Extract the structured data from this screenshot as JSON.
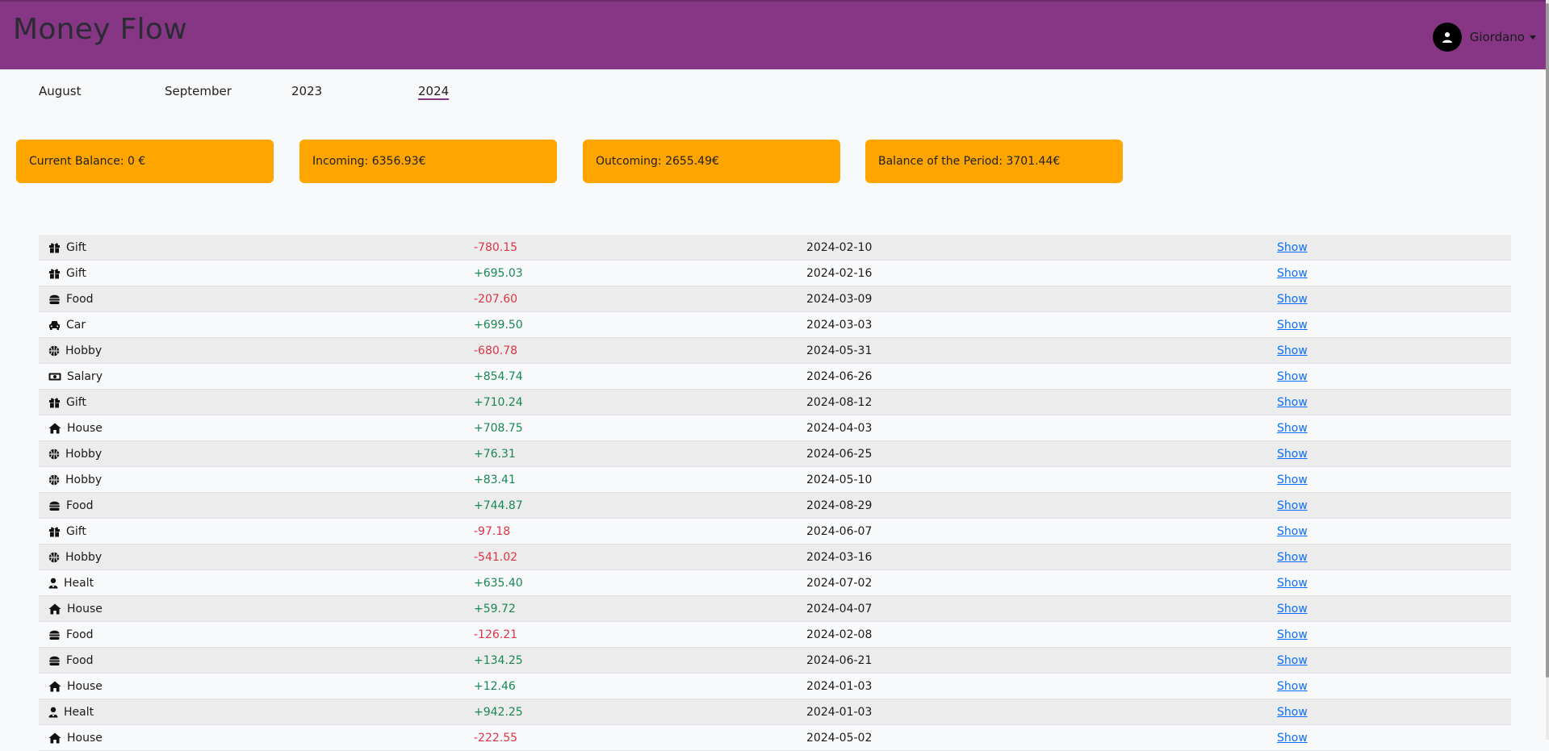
{
  "app": {
    "title": "Money Flow",
    "accent_color": "#873686",
    "card_color": "#ffa500"
  },
  "user": {
    "name": "Giordano",
    "icon": "user-icon"
  },
  "periods": [
    {
      "label": "August",
      "active": false
    },
    {
      "label": "September",
      "active": false
    },
    {
      "label": "2023",
      "active": false
    },
    {
      "label": "2024",
      "active": true
    }
  ],
  "summary": {
    "current_balance": "Current Balance: 0 €",
    "incoming": "Incoming: 6356.93€",
    "outcoming": "Outcoming: 2655.49€",
    "period_balance": "Balance of the Period: 3701.44€"
  },
  "transactions": [
    {
      "category": "Gift",
      "icon": "gift-icon",
      "amount": "-780.15",
      "date": "2024-02-10",
      "action": "Show"
    },
    {
      "category": "Gift",
      "icon": "gift-icon",
      "amount": "+695.03",
      "date": "2024-02-16",
      "action": "Show"
    },
    {
      "category": "Food",
      "icon": "burger-icon",
      "amount": "-207.60",
      "date": "2024-03-09",
      "action": "Show"
    },
    {
      "category": "Car",
      "icon": "car-icon",
      "amount": "+699.50",
      "date": "2024-03-03",
      "action": "Show"
    },
    {
      "category": "Hobby",
      "icon": "basketball-icon",
      "amount": "-680.78",
      "date": "2024-05-31",
      "action": "Show"
    },
    {
      "category": "Salary",
      "icon": "money-bill-icon",
      "amount": "+854.74",
      "date": "2024-06-26",
      "action": "Show"
    },
    {
      "category": "Gift",
      "icon": "gift-icon",
      "amount": "+710.24",
      "date": "2024-08-12",
      "action": "Show"
    },
    {
      "category": "House",
      "icon": "house-icon",
      "amount": "+708.75",
      "date": "2024-04-03",
      "action": "Show"
    },
    {
      "category": "Hobby",
      "icon": "basketball-icon",
      "amount": "+76.31",
      "date": "2024-06-25",
      "action": "Show"
    },
    {
      "category": "Hobby",
      "icon": "basketball-icon",
      "amount": "+83.41",
      "date": "2024-05-10",
      "action": "Show"
    },
    {
      "category": "Food",
      "icon": "burger-icon",
      "amount": "+744.87",
      "date": "2024-08-29",
      "action": "Show"
    },
    {
      "category": "Gift",
      "icon": "gift-icon",
      "amount": "-97.18",
      "date": "2024-06-07",
      "action": "Show"
    },
    {
      "category": "Hobby",
      "icon": "basketball-icon",
      "amount": "-541.02",
      "date": "2024-03-16",
      "action": "Show"
    },
    {
      "category": "Healt",
      "icon": "user-doctor-icon",
      "amount": "+635.40",
      "date": "2024-07-02",
      "action": "Show"
    },
    {
      "category": "House",
      "icon": "house-icon",
      "amount": "+59.72",
      "date": "2024-04-07",
      "action": "Show"
    },
    {
      "category": "Food",
      "icon": "burger-icon",
      "amount": "-126.21",
      "date": "2024-02-08",
      "action": "Show"
    },
    {
      "category": "Food",
      "icon": "burger-icon",
      "amount": "+134.25",
      "date": "2024-06-21",
      "action": "Show"
    },
    {
      "category": "House",
      "icon": "house-icon",
      "amount": "+12.46",
      "date": "2024-01-03",
      "action": "Show"
    },
    {
      "category": "Healt",
      "icon": "user-doctor-icon",
      "amount": "+942.25",
      "date": "2024-01-03",
      "action": "Show"
    },
    {
      "category": "House",
      "icon": "house-icon",
      "amount": "-222.55",
      "date": "2024-05-02",
      "action": "Show"
    }
  ]
}
